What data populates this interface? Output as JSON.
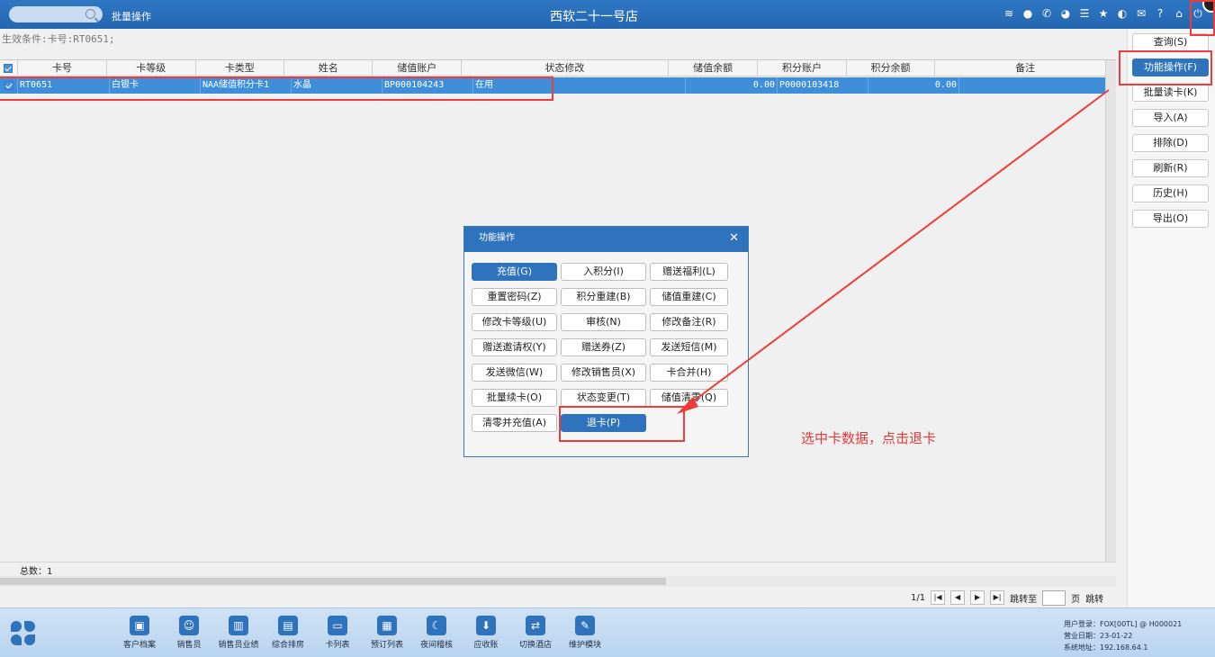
{
  "topbar": {
    "module": "批量操作",
    "store": "西软二十一号店",
    "icons": [
      "wifi-icon",
      "chat-icon",
      "phone-icon",
      "palette-icon",
      "menu-icon",
      "star-icon",
      "theme-icon",
      "mail-icon",
      "help-icon",
      "home-icon",
      "power-icon"
    ]
  },
  "condition": "生效条件:卡号:RT0651;",
  "grid": {
    "columns": [
      "卡号",
      "卡等级",
      "卡类型",
      "姓名",
      "储值账户",
      "状态修改",
      "储值余额",
      "积分账户",
      "积分余额",
      "备注"
    ],
    "rows": [
      {
        "card_no": "RT0651",
        "level": "白银卡",
        "type": "NAA储值积分卡1",
        "name": "水晶",
        "stored_account": "BP000104243",
        "status": "在用",
        "stored_balance": "0.00",
        "points_account": "P0000103418",
        "points_balance": "0.00",
        "remark": ""
      }
    ]
  },
  "total": "总数：1",
  "pager": {
    "page": "1/1",
    "jump_to": "跳转至",
    "page_unit": "页",
    "jump": "跳转"
  },
  "actions": [
    "查询(S)",
    "功能操作(F)",
    "批量读卡(K)",
    "导入(A)",
    "排除(D)",
    "刷新(R)",
    "历史(H)",
    "导出(O)"
  ],
  "dialog": {
    "title": "功能操作",
    "buttons": [
      "充值(G)",
      "入积分(I)",
      "赠送福利(L)",
      "重置密码(Z)",
      "积分重建(B)",
      "储值重建(C)",
      "修改卡等级(U)",
      "审核(N)",
      "修改备注(R)",
      "赠送邀请权(Y)",
      "赠送券(Z)",
      "发送短信(M)",
      "发送微信(W)",
      "修改销售员(X)",
      "卡合并(H)",
      "批量续卡(O)",
      "状态变更(T)",
      "储值清零(Q)",
      "清零并充值(A)",
      "退卡(P)"
    ]
  },
  "note": "选中卡数据，点击退卡",
  "taskbar": [
    "客户档案",
    "销售员",
    "销售员业绩",
    "综合排房",
    "卡列表",
    "预订列表",
    "夜间稽核",
    "应收账",
    "切换酒店",
    "维护模块"
  ],
  "sysinfo": {
    "user": "用户登录：FOX[00TL] @ H000021",
    "date": "营业日期：23-01-22",
    "address": "系统地址：192.168.64.1"
  }
}
